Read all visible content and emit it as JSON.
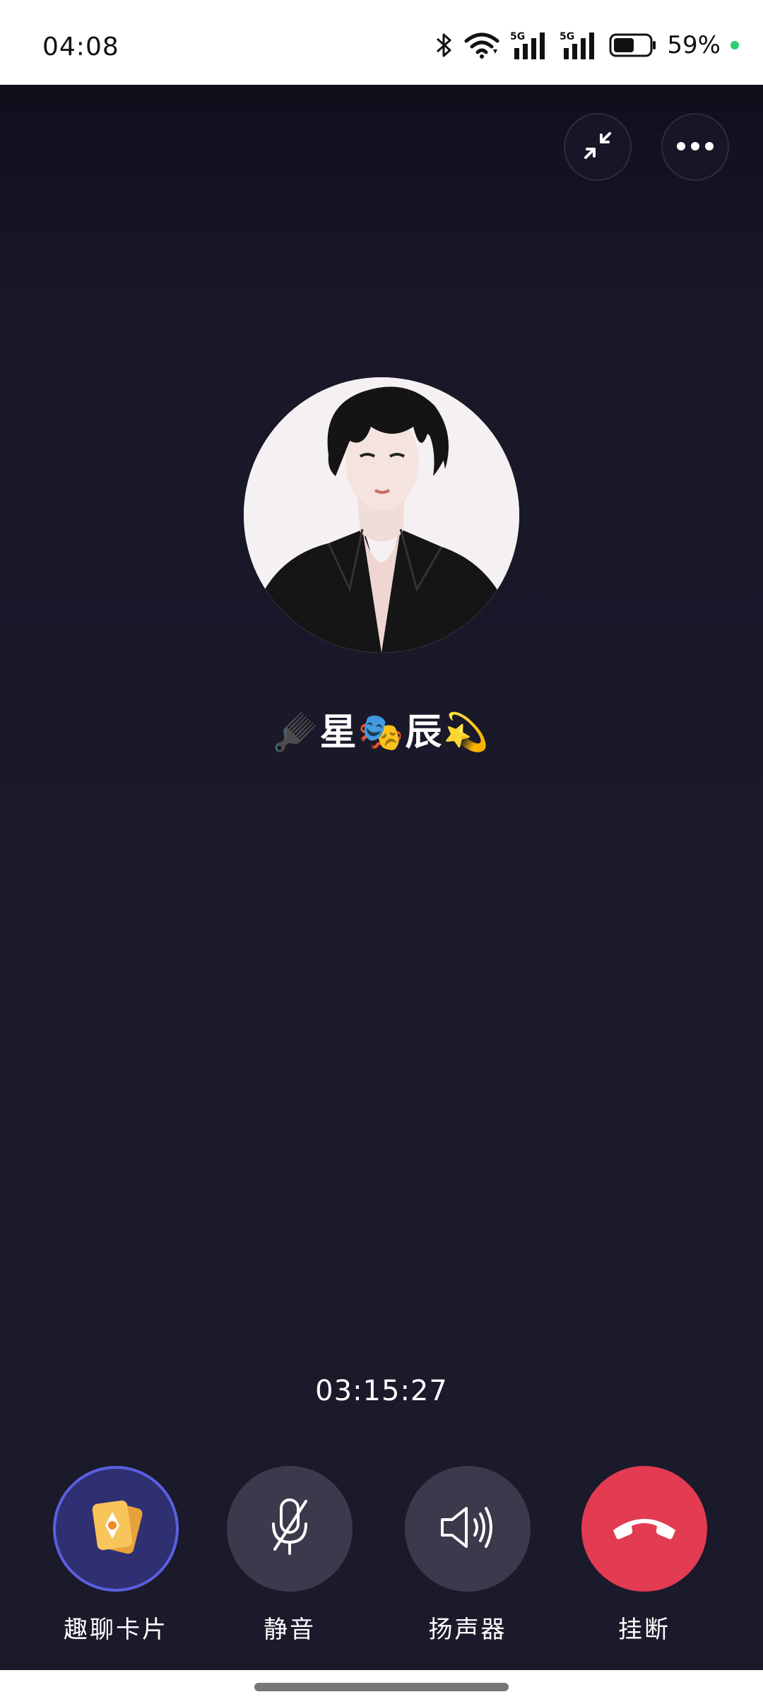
{
  "status_bar": {
    "time": "04:08",
    "battery_percent": "59%",
    "battery_level": 0.59,
    "network_1": "5G",
    "network_2": "5G",
    "icons": [
      "bluetooth-icon",
      "wifi-icon",
      "signal-5g-icon",
      "signal-5g-icon",
      "battery-icon"
    ]
  },
  "top_controls": {
    "minimize_icon": "minimize-icon",
    "more_icon": "more-options-icon"
  },
  "caller": {
    "name": "🪮星🎭辰💫"
  },
  "call": {
    "duration": "03:15:27"
  },
  "controls": {
    "cards_label": "趣聊卡片",
    "mute_label": "静音",
    "speaker_label": "扬声器",
    "hangup_label": "挂断"
  },
  "colors": {
    "background": "#1a1a2b",
    "control_button": "#3a3a4c",
    "hangup": "#e23b52",
    "cards_button": "#2e3072",
    "cards_border": "#5b5fe0",
    "battery_dot": "#2ecc71"
  }
}
